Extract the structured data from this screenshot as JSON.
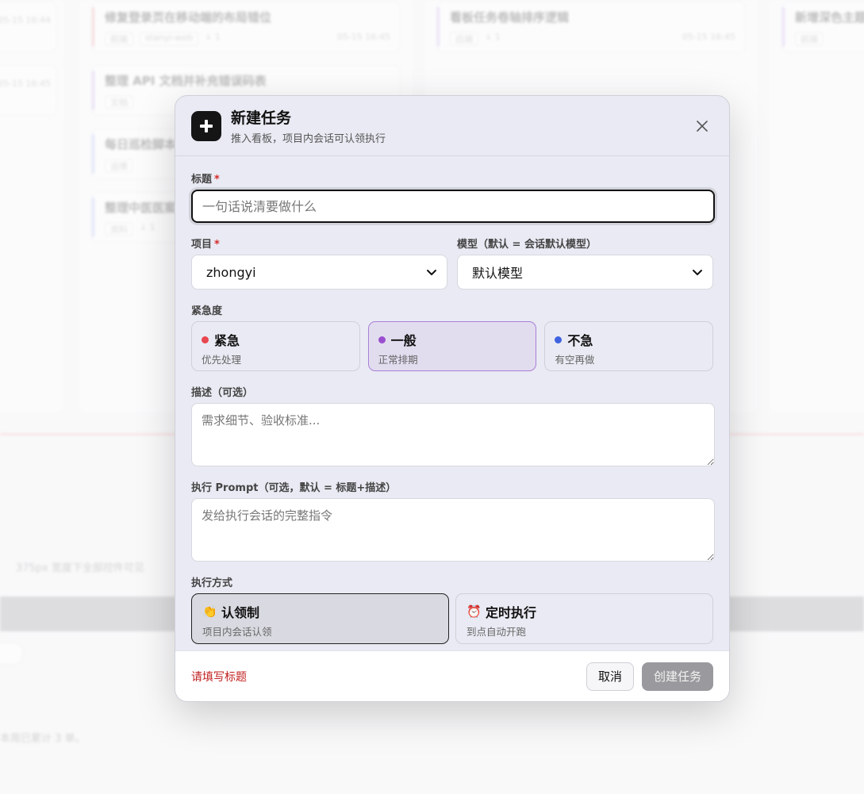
{
  "modal": {
    "title": "新建任务",
    "subtitle": "推入看板，项目内会话可认领执行",
    "title_field": {
      "label": "标题",
      "required_mark": "*",
      "placeholder": "一句话说清要做什么",
      "value": ""
    },
    "project_field": {
      "label": "项目",
      "required_mark": "*",
      "value": "zhongyi"
    },
    "model_field": {
      "label": "模型（默认 = 会话默认模型）",
      "value": "默认模型"
    },
    "urgency": {
      "label": "紧急度",
      "options": [
        {
          "name": "紧急",
          "desc": "优先处理",
          "color": "#e8474f",
          "selected": false
        },
        {
          "name": "一般",
          "desc": "正常排期",
          "color": "#9b4fd0",
          "selected": true
        },
        {
          "name": "不急",
          "desc": "有空再做",
          "color": "#3f63e0",
          "selected": false
        }
      ]
    },
    "description": {
      "label": "描述（可选）",
      "placeholder": "需求细节、验收标准..."
    },
    "prompt": {
      "label": "执行 Prompt（可选，默认 = 标题+描述）",
      "placeholder": "发给执行会话的完整指令"
    },
    "execution": {
      "label": "执行方式",
      "options": [
        {
          "icon": "hand-icon",
          "glyph": "👏",
          "name": "认领制",
          "desc": "项目内会话认领",
          "selected": true
        },
        {
          "icon": "alarm-clock-icon",
          "glyph": "⏰",
          "name": "定时执行",
          "desc": "到点自动开跑",
          "selected": false
        }
      ]
    },
    "footer": {
      "error": "请填写标题",
      "cancel_label": "取消",
      "create_label": "创建任务"
    }
  },
  "background": {
    "cards": [
      {
        "title": "修复登录页在移动端的布局错位",
        "chips": [
          "前端",
          "stanyi-web"
        ],
        "meta": "↓ 1",
        "time": "05-15 16:45"
      },
      {
        "title": "整理 API 文档并补充错误码表",
        "chips": [
          "文档"
        ],
        "meta": "",
        "time": ""
      },
      {
        "title": "每日巡检脚本",
        "chips": [
          "运维"
        ],
        "meta": "",
        "time": ""
      },
      {
        "title": "整理中医医案",
        "chips": [
          "资料"
        ],
        "meta": "↓ 1",
        "time": ""
      },
      {
        "title": "看板任务卷轴排序逻辑",
        "chips": [
          "后端"
        ],
        "meta": "↓ 1",
        "time": "05-15 16:45"
      },
      {
        "title": "新增深色主题支持",
        "chips": [
          "前端"
        ],
        "meta": "",
        "time": ""
      }
    ],
    "notes": [
      "375px 宽度下全部控件可见",
      "本周已累计 3 单。"
    ]
  }
}
